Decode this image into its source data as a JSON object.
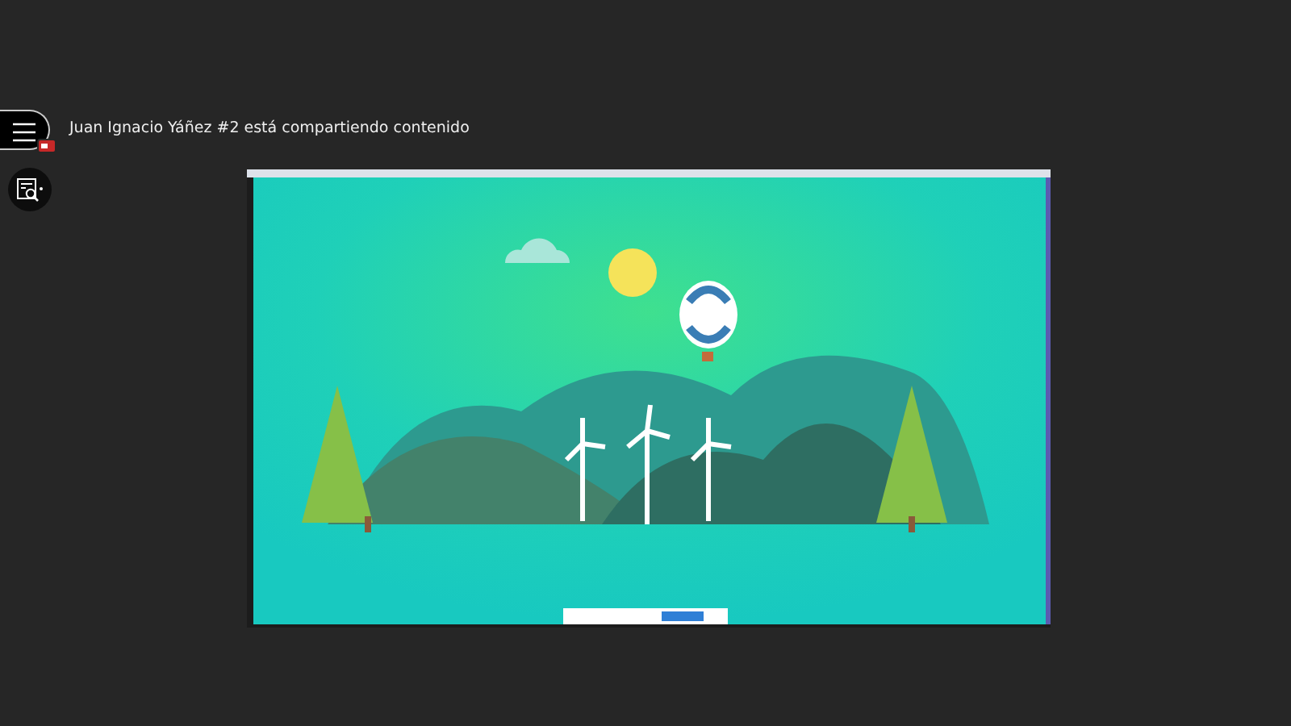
{
  "sharing_banner": {
    "text": "Juan Ignacio Yáñez #2 está compartiendo contenido"
  }
}
